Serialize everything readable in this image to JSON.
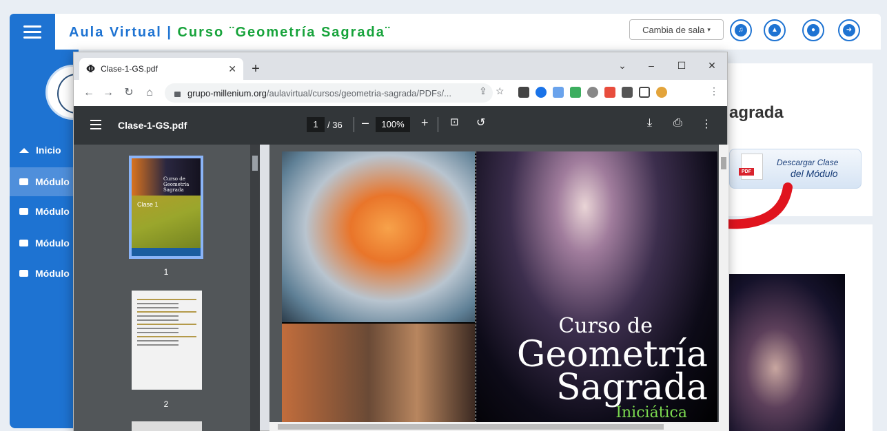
{
  "header": {
    "title_prefix": "Aula Virtual | ",
    "title_course": "Curso ¨Geometría Sagrada¨",
    "sala_select": "Cambia de sala",
    "buttons": [
      "music-icon",
      "graduation-cap-icon",
      "user-icon",
      "logout-icon"
    ]
  },
  "sidebar": {
    "items": [
      {
        "label": "Inicio",
        "icon": "home-icon"
      },
      {
        "label": "Módulo",
        "icon": "folder-open-icon"
      },
      {
        "label": "Módulo",
        "icon": "folder-icon"
      },
      {
        "label": "Módulo",
        "icon": "folder-icon"
      },
      {
        "label": "Módulo",
        "icon": "folder-icon"
      }
    ]
  },
  "content": {
    "title_fragment": "agrada",
    "download_line1": "Descargar Clase",
    "download_line2": "del Módulo"
  },
  "browser": {
    "tab_title": "Clase-1-GS.pdf",
    "tab_favicon": "Φ",
    "url_host": "grupo-millenium.org",
    "url_path": "/aulavirtual/cursos/geometria-sagrada/PDFs/...",
    "window_controls": [
      "⌄",
      "–",
      "☐",
      "✕"
    ]
  },
  "pdf": {
    "filename": "Clase-1-GS.pdf",
    "current_page": "1",
    "total_pages": "/ 36",
    "zoom": "100%",
    "thumbnails": [
      {
        "number": "1",
        "selected": true
      },
      {
        "number": "2",
        "selected": false
      }
    ],
    "thumb1_title": "Curso de Geometría Sagrada",
    "thumb1_class": "Clase 1",
    "cover": {
      "line1": "Curso de",
      "line2": "Geometría",
      "line3": "Sagrada",
      "line4": "Iniciática"
    }
  },
  "colors": {
    "brand_blue": "#1e73d2",
    "brand_green": "#17a33b",
    "pdf_toolbar": "#323639",
    "pdf_background": "#525659"
  }
}
